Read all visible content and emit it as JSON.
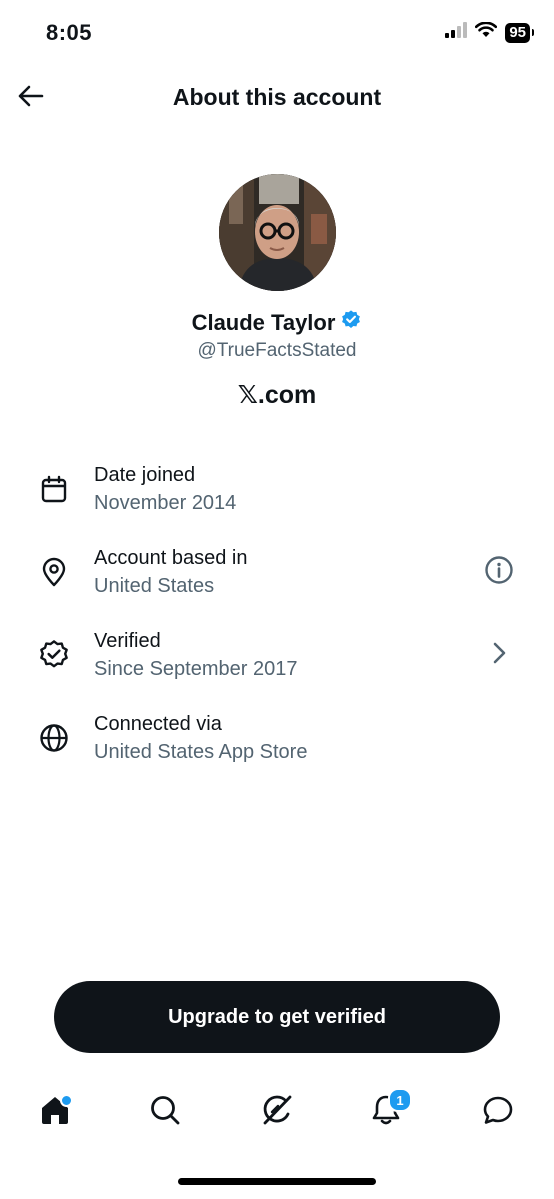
{
  "status_bar": {
    "time": "8:05",
    "battery": "95"
  },
  "header": {
    "title": "About this account"
  },
  "profile": {
    "name": "Claude Taylor",
    "handle": "@TrueFactsStated",
    "website": "𝕏.com",
    "verified": true
  },
  "info": [
    {
      "icon": "calendar-icon",
      "title": "Date joined",
      "value": "November 2014"
    },
    {
      "icon": "location-pin-icon",
      "title": "Account based in",
      "value": "United States",
      "action": "info-icon"
    },
    {
      "icon": "verified-badge-icon",
      "title": "Verified",
      "value": "Since September 2017",
      "action": "chevron-right-icon"
    },
    {
      "icon": "globe-icon",
      "title": "Connected via",
      "value": "United States App Store"
    }
  ],
  "upgrade_button": {
    "label": "Upgrade to get verified"
  },
  "tab_bar": {
    "items": [
      "home",
      "search",
      "grok",
      "notifications",
      "messages"
    ],
    "notifications_badge": "1"
  },
  "colors": {
    "text": "#0f1419",
    "secondary": "#536471",
    "accent": "#1d9bf0"
  }
}
